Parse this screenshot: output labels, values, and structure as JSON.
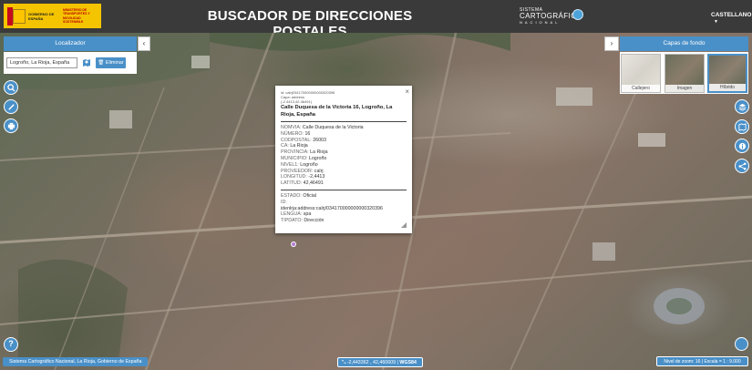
{
  "header": {
    "gov_text": "GOBIERNO DE ESPAÑA",
    "ministry_text": "MINISTERIO DE TRANSPORTES Y MOVILIDAD SOSTENIBLE",
    "title": "BUSCADOR DE DIRECCIONES POSTALES",
    "scn_line1": "SISTEMA",
    "scn_line2": "CARTOGRÁFICO",
    "scn_line3": "NACIONAL",
    "language": "CASTELLANO"
  },
  "localizador": {
    "title": "Localizador",
    "search_value": "Logroño, La Rioja, España",
    "clear_label": "Eliminar"
  },
  "capas": {
    "title": "Capas de fondo",
    "layers": [
      {
        "label": "Callejero"
      },
      {
        "label": "Imagen"
      },
      {
        "label": "Híbrido"
      }
    ],
    "selected": "Híbrido"
  },
  "popup": {
    "meta_id": "id: calrj034170000000000320396",
    "meta_capa": "Capa: address",
    "meta_coords": "(-2.4413,42.46491)",
    "title": "Calle Duquesa de la Victoria 16, Logroño, La Rioja, España",
    "fields": [
      {
        "k": "NOMVIA:",
        "v": "Calle Duquesa de la Victoria"
      },
      {
        "k": "NÚMERO:",
        "v": "16"
      },
      {
        "k": "CODPOSTAL:",
        "v": "26003"
      },
      {
        "k": "CA:",
        "v": "La Rioja"
      },
      {
        "k": "PROVINCIA:",
        "v": "La Rioja"
      },
      {
        "k": "MUNICIPIO:",
        "v": "Logroño"
      },
      {
        "k": "NIVEL1:",
        "v": "Logroño"
      },
      {
        "k": "PROVEEDOR:",
        "v": "calrj"
      },
      {
        "k": "LONGITUD:",
        "v": "-2,4413"
      },
      {
        "k": "LATITUD:",
        "v": "42,46491"
      }
    ],
    "fields2": [
      {
        "k": "ESTADO:",
        "v": "Oficial"
      },
      {
        "k": "ID:",
        "v": ""
      },
      {
        "k": "",
        "v": "idenlrja:address:calrj/034170000000000320396"
      },
      {
        "k": "LENGUA:",
        "v": "spa"
      },
      {
        "k": "TIPDATO:",
        "v": "Dirección"
      }
    ]
  },
  "footer": {
    "attribution": "Sistema Cartográfico Nacional,    La Rioja, Gobierno de España",
    "coords": "-2,443362 , 42,460609 |",
    "crs": "WGS84",
    "zoom": "Nivel de zoom: 16 | Escala = 1 : 9.000"
  },
  "colors": {
    "accent": "#4a90c8",
    "header_bg": "#3a3a3a",
    "gov_yellow": "#f5c400"
  }
}
